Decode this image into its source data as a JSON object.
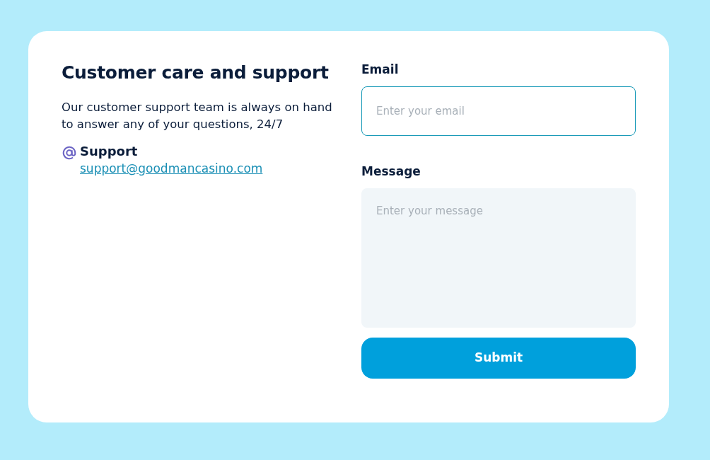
{
  "contact": {
    "title": "Customer care and support",
    "description": "Our customer support team is always on hand to answer any of your questions, 24/7",
    "channel": {
      "label": "Support",
      "link": "support@goodmancasino.com"
    }
  },
  "form": {
    "fields": [
      {
        "kind": "input",
        "label": "Email",
        "placeholder": "Enter your email",
        "focused": true
      },
      {
        "kind": "textarea",
        "label": "Message",
        "placeholder": "Enter your message",
        "focused": false
      }
    ],
    "submit": "Submit"
  }
}
